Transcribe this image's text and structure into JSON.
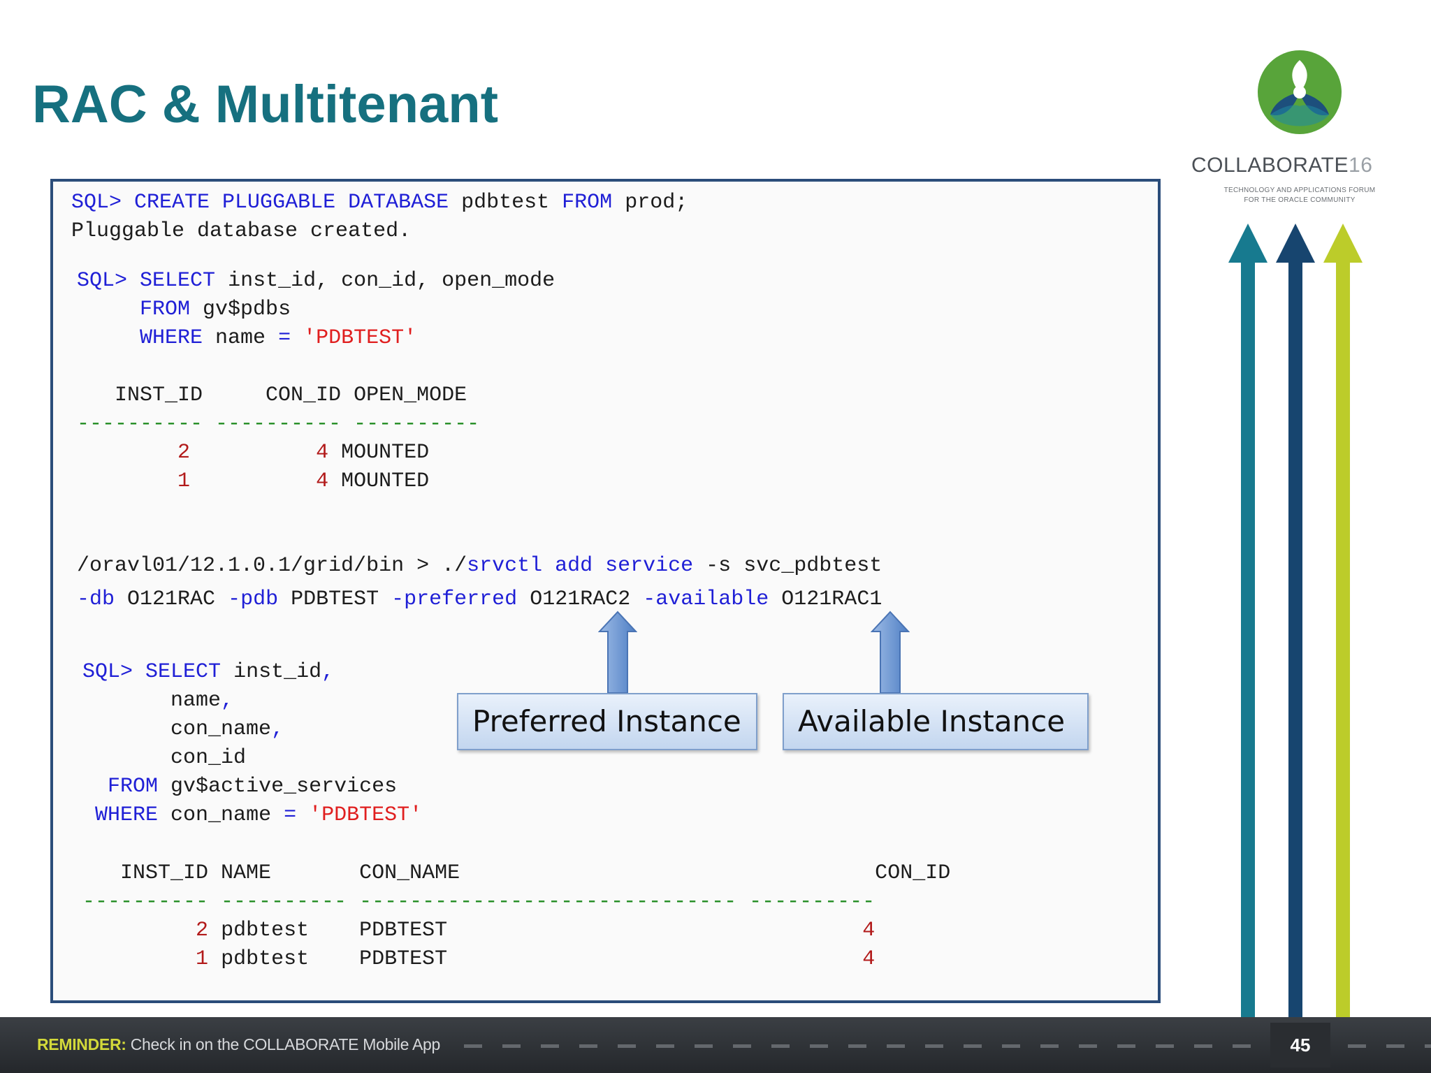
{
  "slide": {
    "title": "RAC & Multitenant",
    "page_number": "45"
  },
  "logo": {
    "brand": "COLLABORATE",
    "year": "16",
    "tagline_1": "TECHNOLOGY AND APPLICATIONS FORUM",
    "tagline_2": "FOR THE ORACLE COMMUNITY"
  },
  "footer": {
    "reminder_label": "REMINDER:",
    "reminder_text": " Check in on the COLLABORATE Mobile App"
  },
  "code": {
    "block1": {
      "prompt": "SQL>",
      "create_kw": "CREATE PLUGGABLE DATABASE",
      "pdb_name": "pdbtest",
      "from_kw": "FROM",
      "source": "prod;",
      "result": "Pluggable database created."
    },
    "block2": {
      "prompt": "SQL>",
      "select_kw": "SELECT",
      "columns": "inst_id, con_id, open_mode",
      "from_kw": "FROM",
      "view": "gv$pdbs",
      "where_kw": "WHERE",
      "cond_col": "name",
      "eq": "=",
      "cond_val": "'PDBTEST'",
      "header": "   INST_ID     CON_ID OPEN_MODE",
      "rule": "---------- ---------- ----------",
      "rows": [
        {
          "inst_id": "2",
          "con_id": "4",
          "open_mode": "MOUNTED"
        },
        {
          "inst_id": "1",
          "con_id": "4",
          "open_mode": "MOUNTED"
        }
      ]
    },
    "srvctl": {
      "path": "/oravl01/12.1.0.1/grid/bin > ./",
      "cmd": "srvctl add service",
      "flag_s": "-s",
      "service": "svc_pdbtest",
      "flag_db": "-db",
      "db": "O121RAC",
      "flag_pdb": "-pdb",
      "pdb": "PDBTEST",
      "flag_preferred": "-preferred",
      "preferred": "O121RAC2",
      "flag_available": "-available",
      "available": "O121RAC1"
    },
    "block3": {
      "prompt": "SQL>",
      "select_kw": "SELECT",
      "col1": "inst_id",
      "col2": "name",
      "col3": "con_name",
      "col4": "con_id",
      "comma": ",",
      "from_kw": "FROM",
      "view": "gv$active_services",
      "where_kw": "WHERE",
      "cond_col": "con_name",
      "eq": "=",
      "cond_val": "'PDBTEST'",
      "header": "   INST_ID NAME       CON_NAME                                 CON_ID",
      "rule": "---------- ---------- ------------------------------ ----------",
      "rows": [
        {
          "inst_id": "2",
          "name": "pdbtest",
          "con_name": "PDBTEST",
          "con_id": "4"
        },
        {
          "inst_id": "1",
          "name": "pdbtest",
          "con_name": "PDBTEST",
          "con_id": "4"
        }
      ]
    }
  },
  "callouts": {
    "preferred": "Preferred Instance",
    "available": "Available Instance"
  },
  "colors": {
    "title": "#16707f",
    "keyword": "#1f1fd6",
    "number": "#b21a1a",
    "string": "#e01f1f",
    "rule": "#1d8a1d",
    "panel_border": "#2b4d7a",
    "arrow_teal": "#177a8f",
    "arrow_navy": "#17456f",
    "arrow_lime": "#bccc2a"
  }
}
